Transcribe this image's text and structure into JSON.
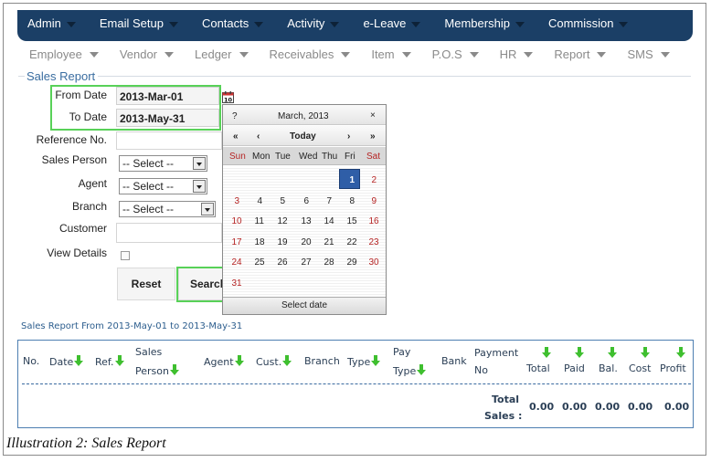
{
  "top_nav": [
    "Admin",
    "Email Setup",
    "Contacts",
    "Activity",
    "e-Leave",
    "Membership",
    "Commission"
  ],
  "sub_nav": [
    "Employee",
    "Vendor",
    "Ledger",
    "Receivables",
    "Item",
    "P.O.S",
    "HR",
    "Report",
    "SMS"
  ],
  "form": {
    "legend": "Sales Report",
    "from_date_label": "From Date",
    "from_date_value": "2013-Mar-01",
    "to_date_label": "To Date",
    "to_date_value": "2013-May-31",
    "reference_label": "Reference No.",
    "sales_person_label": "Sales Person",
    "agent_label": "Agent",
    "branch_label": "Branch",
    "customer_label": "Customer",
    "view_details_label": "View Details",
    "select_placeholder": "-- Select --",
    "reset_label": "Reset",
    "search_label": "Search",
    "calendar_icon_text": "10"
  },
  "calendar": {
    "help": "?",
    "month_label": "March, 2013",
    "close": "×",
    "prev_year": "«",
    "prev_month": "‹",
    "today": "Today",
    "next_month": "›",
    "next_year": "»",
    "days": [
      "Sun",
      "Mon",
      "Tue",
      "Wed",
      "Thu",
      "Fri",
      "Sat"
    ],
    "weeks": [
      [
        "",
        "",
        "",
        "",
        "",
        "1",
        "2"
      ],
      [
        "3",
        "4",
        "5",
        "6",
        "7",
        "8",
        "9"
      ],
      [
        "10",
        "11",
        "12",
        "13",
        "14",
        "15",
        "16"
      ],
      [
        "17",
        "18",
        "19",
        "20",
        "21",
        "22",
        "23"
      ],
      [
        "24",
        "25",
        "26",
        "27",
        "28",
        "29",
        "30"
      ],
      [
        "31",
        "",
        "",
        "",
        "",
        "",
        ""
      ]
    ],
    "selected_day": "1",
    "footer": "Select date"
  },
  "report": {
    "title": "Sales Report From 2013-May-01 to 2013-May-31",
    "headers": {
      "no": "No.",
      "date": "Date",
      "ref": "Ref.",
      "sales_person_1": "Sales",
      "sales_person_2": "Person",
      "agent": "Agent",
      "cust": "Cust.",
      "branch": "Branch",
      "type": "Type",
      "pay_type_1": "Pay",
      "pay_type_2": "Type",
      "bank": "Bank",
      "payment_no_1": "Payment",
      "payment_no_2": "No",
      "total": "Total",
      "paid": "Paid",
      "bal": "Bal.",
      "cost": "Cost",
      "profit": "Profit"
    },
    "total_sales_label_1": "Total",
    "total_sales_label_2": "Sales :",
    "totals": {
      "total": "0.00",
      "paid": "0.00",
      "bal": "0.00",
      "cost": "0.00",
      "profit": "0.00"
    }
  },
  "caption": "Illustration 2: Sales Report",
  "colors": {
    "nav_bg": "#1b3f66",
    "highlight_green": "#58d158",
    "selected_day_bg": "#2f5ea7",
    "weekend_red": "#b52323",
    "sort_arrow_green": "#3fbf2f"
  }
}
